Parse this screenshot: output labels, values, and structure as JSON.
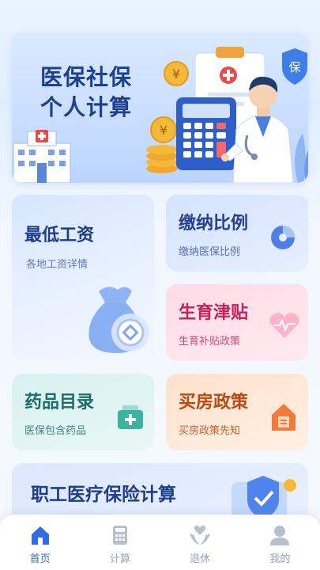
{
  "banner": {
    "title_line1": "医保社保",
    "title_line2": "个人计算",
    "shield_text": "保",
    "coin_symbol": "¥"
  },
  "cards": {
    "min_wage": {
      "title": "最低工资",
      "subtitle": "各地工资详情"
    },
    "contribution_ratio": {
      "title": "缴纳比例",
      "subtitle": "缴纳医保比例"
    },
    "maternity": {
      "title": "生育津贴",
      "subtitle": "生育补贴政策"
    },
    "drug_catalog": {
      "title": "药品目录",
      "subtitle": "医保包含药品"
    },
    "housing": {
      "title": "买房政策",
      "subtitle": "买房政策先知"
    },
    "employee_calc": {
      "title": "职工医疗保险计算"
    }
  },
  "tabbar": {
    "items": [
      {
        "label": "首页",
        "icon": "home-icon",
        "active": true
      },
      {
        "label": "计算",
        "icon": "calculator-icon",
        "active": false
      },
      {
        "label": "退休",
        "icon": "heart-hands-icon",
        "active": false
      },
      {
        "label": "我的",
        "icon": "user-icon",
        "active": false
      }
    ]
  },
  "colors": {
    "accent": "#2f6ce6",
    "inactive": "#9aa3b5"
  }
}
